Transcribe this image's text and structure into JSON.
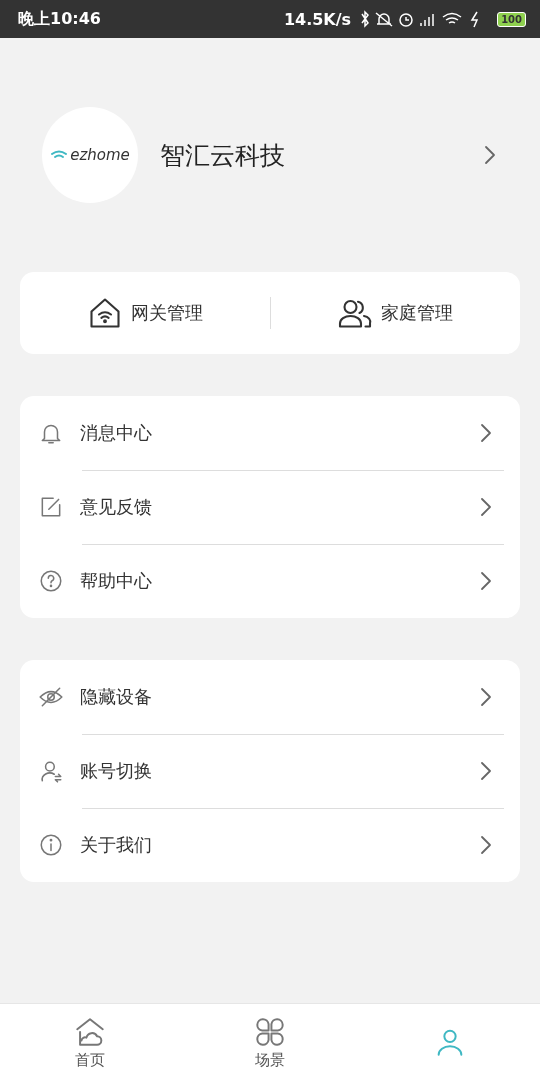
{
  "status_bar": {
    "time": "晚上10:46",
    "speed": "14.5K/s",
    "battery": "100"
  },
  "profile": {
    "logo_text": "ezhome",
    "name": "智汇云科技"
  },
  "quick_actions": [
    {
      "kind": "gateway",
      "label": "网关管理"
    },
    {
      "kind": "family",
      "label": "家庭管理"
    }
  ],
  "menu_groups": [
    [
      {
        "kind": "bell",
        "label": "消息中心"
      },
      {
        "kind": "edit",
        "label": "意见反馈"
      },
      {
        "kind": "help",
        "label": "帮助中心"
      }
    ],
    [
      {
        "kind": "hidden",
        "label": "隐藏设备"
      },
      {
        "kind": "switch",
        "label": "账号切换"
      },
      {
        "kind": "info",
        "label": "关于我们"
      }
    ]
  ],
  "tabs": [
    {
      "kind": "home",
      "label": "首页",
      "selected": false
    },
    {
      "kind": "scene",
      "label": "场景",
      "selected": false
    },
    {
      "kind": "me",
      "selected": true
    }
  ]
}
